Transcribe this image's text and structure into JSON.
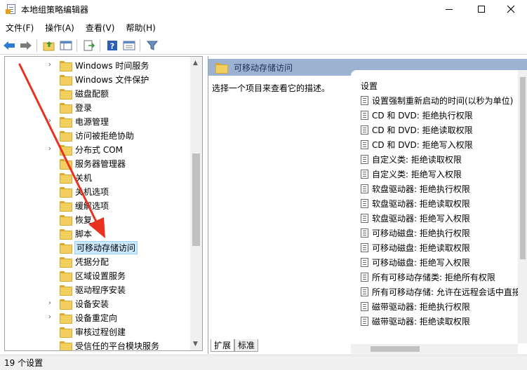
{
  "window": {
    "title": "本地组策略编辑器",
    "controls": {
      "minimize": "minimize",
      "maximize": "maximize",
      "close": "close"
    }
  },
  "menu": [
    {
      "label": "文件(F)"
    },
    {
      "label": "操作(A)"
    },
    {
      "label": "查看(V)"
    },
    {
      "label": "帮助(H)"
    }
  ],
  "toolbar": {
    "icons": [
      "back-arrow-icon",
      "forward-arrow-icon",
      "up-folder-icon",
      "show-hide-tree-icon",
      "export-list-icon",
      "help-icon",
      "properties-icon",
      "filter-icon"
    ]
  },
  "tree": {
    "items": [
      {
        "label": "Windows 时间服务",
        "expandable": true
      },
      {
        "label": "Windows 文件保护",
        "expandable": false
      },
      {
        "label": "磁盘配额",
        "expandable": false
      },
      {
        "label": "登录",
        "expandable": false
      },
      {
        "label": "电源管理",
        "expandable": true
      },
      {
        "label": "访问被拒绝协助",
        "expandable": false
      },
      {
        "label": "分布式 COM",
        "expandable": true
      },
      {
        "label": "服务器管理器",
        "expandable": false
      },
      {
        "label": "关机",
        "expandable": false
      },
      {
        "label": "关机选项",
        "expandable": false
      },
      {
        "label": "缓解选项",
        "expandable": false
      },
      {
        "label": "恢复",
        "expandable": false
      },
      {
        "label": "脚本",
        "expandable": false
      },
      {
        "label": "可移动存储访问",
        "expandable": false,
        "selected": true
      },
      {
        "label": "凭据分配",
        "expandable": false
      },
      {
        "label": "区域设置服务",
        "expandable": false
      },
      {
        "label": "驱动程序安装",
        "expandable": false
      },
      {
        "label": "设备安装",
        "expandable": true
      },
      {
        "label": "设备重定向",
        "expandable": true
      },
      {
        "label": "审核过程创建",
        "expandable": false
      },
      {
        "label": "受信任的平台模块服务",
        "expandable": false
      }
    ]
  },
  "details": {
    "header": "可移动存储访问",
    "description": "选择一个项目来查看它的描述。",
    "column_header": "设置",
    "settings": [
      "设置强制重新启动的时间(以秒为单位)",
      "CD 和 DVD: 拒绝执行权限",
      "CD 和 DVD: 拒绝读取权限",
      "CD 和 DVD: 拒绝写入权限",
      "自定义类: 拒绝读取权限",
      "自定义类: 拒绝写入权限",
      "软盘驱动器: 拒绝执行权限",
      "软盘驱动器: 拒绝读取权限",
      "软盘驱动器: 拒绝写入权限",
      "可移动磁盘: 拒绝执行权限",
      "可移动磁盘: 拒绝读取权限",
      "可移动磁盘: 拒绝写入权限",
      "所有可移动存储类: 拒绝所有权限",
      "所有可移动存储: 允许在远程会话中直接",
      "磁带驱动器: 拒绝执行权限",
      "磁带驱动器: 拒绝读取权限"
    ]
  },
  "tabs": [
    {
      "label": "扩展"
    },
    {
      "label": "标准"
    }
  ],
  "status": {
    "text": "19 个设置"
  },
  "colors": {
    "header_band": "#9cb2d2",
    "selection": "#cce8ff",
    "annotation_arrow": "#e8311f"
  }
}
